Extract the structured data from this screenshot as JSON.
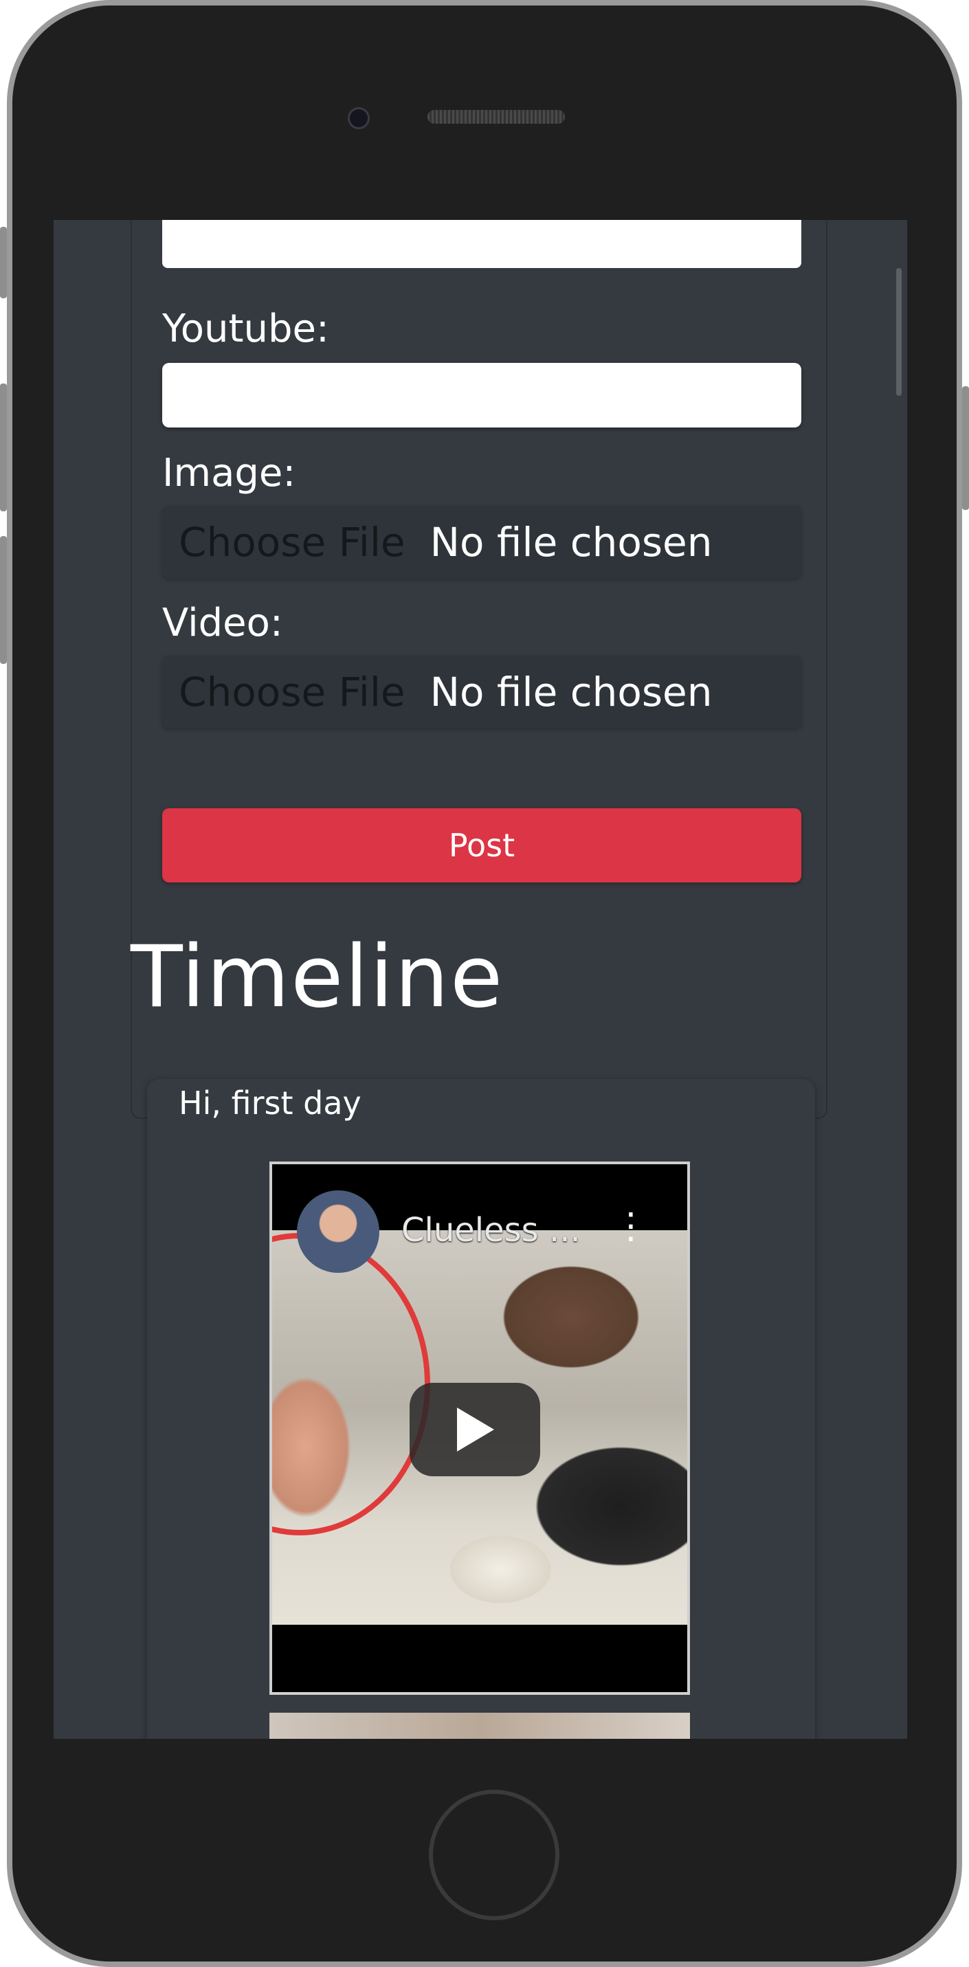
{
  "form": {
    "youtube_label": "Youtube:",
    "image_label": "Image:",
    "video_label": "Video:",
    "image_file": {
      "button": "Choose File",
      "status": "No file chosen"
    },
    "video_file": {
      "button": "Choose File",
      "status": "No file chosen"
    },
    "post_button": "Post"
  },
  "timeline": {
    "title": "Timeline",
    "posts": [
      {
        "text": "Hi, first day",
        "video": {
          "title": "Clueless ...",
          "menu_glyph": "⋮"
        }
      }
    ]
  },
  "colors": {
    "screen_bg": "#343a40",
    "post_button": "#dc3545",
    "input_bg": "#ffffff",
    "text": "#ffffff"
  }
}
